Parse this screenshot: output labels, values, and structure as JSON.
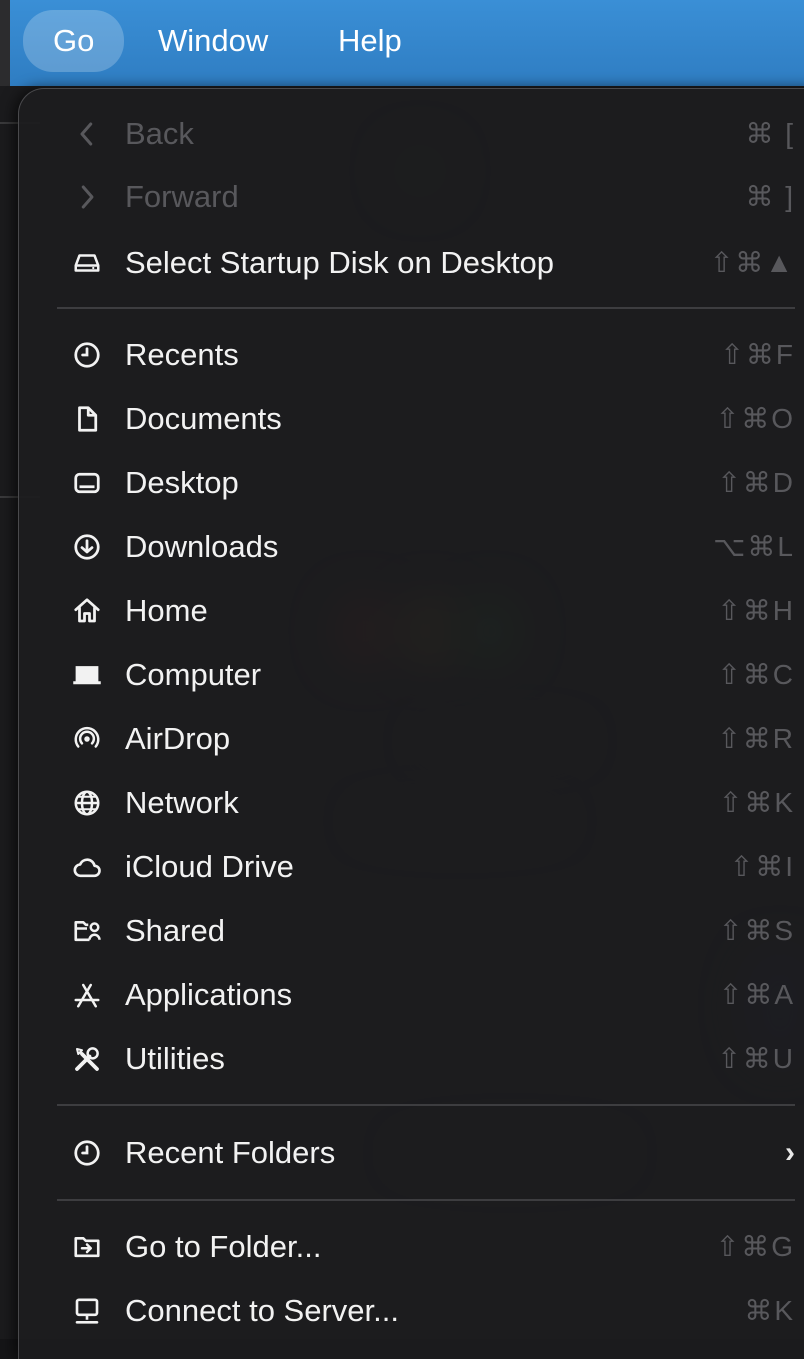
{
  "menubar": {
    "items": [
      {
        "label": "Go",
        "active": true
      },
      {
        "label": "Window",
        "active": false
      },
      {
        "label": "Help",
        "active": false
      }
    ]
  },
  "menu": {
    "items": [
      {
        "label": "Back",
        "shortcut": "⌘ [",
        "icon": "chevron-left-icon",
        "disabled": true
      },
      {
        "label": "Forward",
        "shortcut": "⌘ ]",
        "icon": "chevron-right-icon",
        "disabled": true
      },
      {
        "label": "Select Startup Disk on Desktop",
        "shortcut": "⇧⌘▲",
        "icon": "disk-icon"
      },
      {
        "label": "Recents",
        "shortcut": "⇧⌘F",
        "icon": "clock-icon"
      },
      {
        "label": "Documents",
        "shortcut": "⇧⌘O",
        "icon": "document-icon"
      },
      {
        "label": "Desktop",
        "shortcut": "⇧⌘D",
        "icon": "desktop-icon"
      },
      {
        "label": "Downloads",
        "shortcut": "⌥⌘L",
        "icon": "download-icon"
      },
      {
        "label": "Home",
        "shortcut": "⇧⌘H",
        "icon": "home-icon"
      },
      {
        "label": "Computer",
        "shortcut": "⇧⌘C",
        "icon": "laptop-icon"
      },
      {
        "label": "AirDrop",
        "shortcut": "⇧⌘R",
        "icon": "airdrop-icon"
      },
      {
        "label": "Network",
        "shortcut": "⇧⌘K",
        "icon": "globe-icon"
      },
      {
        "label": "iCloud Drive",
        "shortcut": "⇧⌘I",
        "icon": "cloud-icon"
      },
      {
        "label": "Shared",
        "shortcut": "⇧⌘S",
        "icon": "shared-folder-icon"
      },
      {
        "label": "Applications",
        "shortcut": "⇧⌘A",
        "icon": "applications-icon"
      },
      {
        "label": "Utilities",
        "shortcut": "⇧⌘U",
        "icon": "tools-icon"
      },
      {
        "label": "Recent Folders",
        "shortcut": "›",
        "icon": "clock-icon"
      },
      {
        "label": "Go to Folder...",
        "shortcut": "⇧⌘G",
        "icon": "go-folder-icon"
      },
      {
        "label": "Connect to Server...",
        "shortcut": "⌘K",
        "icon": "server-icon"
      }
    ]
  }
}
